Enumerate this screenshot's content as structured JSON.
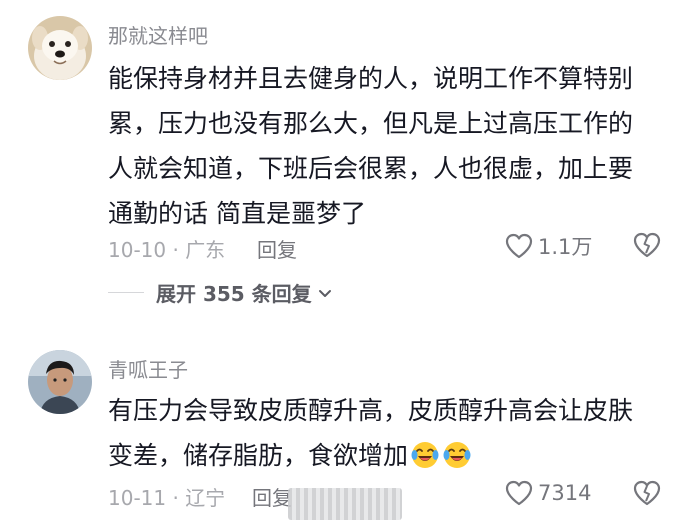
{
  "comments": [
    {
      "username": "那就这样吧",
      "content_lines": [
        "能保持身材并且去健身的人，说明工作不算特别",
        "累，压力也没有那么大，但凡是上过高压工作的",
        "人就会知道，下班后会很累，人也很虚，加上要",
        "通勤的话 简直是噩梦了"
      ],
      "date_location": "10-10 · 广东",
      "reply_label": "回复",
      "like_count": "1.1万",
      "avatar": "dog-avatar"
    },
    {
      "username": "青呱王子",
      "content_lines": [
        "有压力会导致皮质醇升高，皮质醇升高会让皮肤",
        "变差，储存脂肪，食欲增加"
      ],
      "date_location": "10-11 · 辽宁",
      "reply_label": "回复",
      "like_count": "7314",
      "avatar": "person-avatar",
      "emojis": [
        "crying-laughing-emoji",
        "crying-laughing-emoji"
      ]
    }
  ],
  "expand_replies": {
    "label": "展开 355 条回复"
  },
  "colors": {
    "username": "#8a8b91",
    "content": "#161823",
    "meta": "#a7a8ad",
    "action": "#75767c"
  },
  "icons": {
    "like": "heart-outline-icon",
    "dislike": "broken-heart-icon",
    "expand": "chevron-down-icon"
  }
}
